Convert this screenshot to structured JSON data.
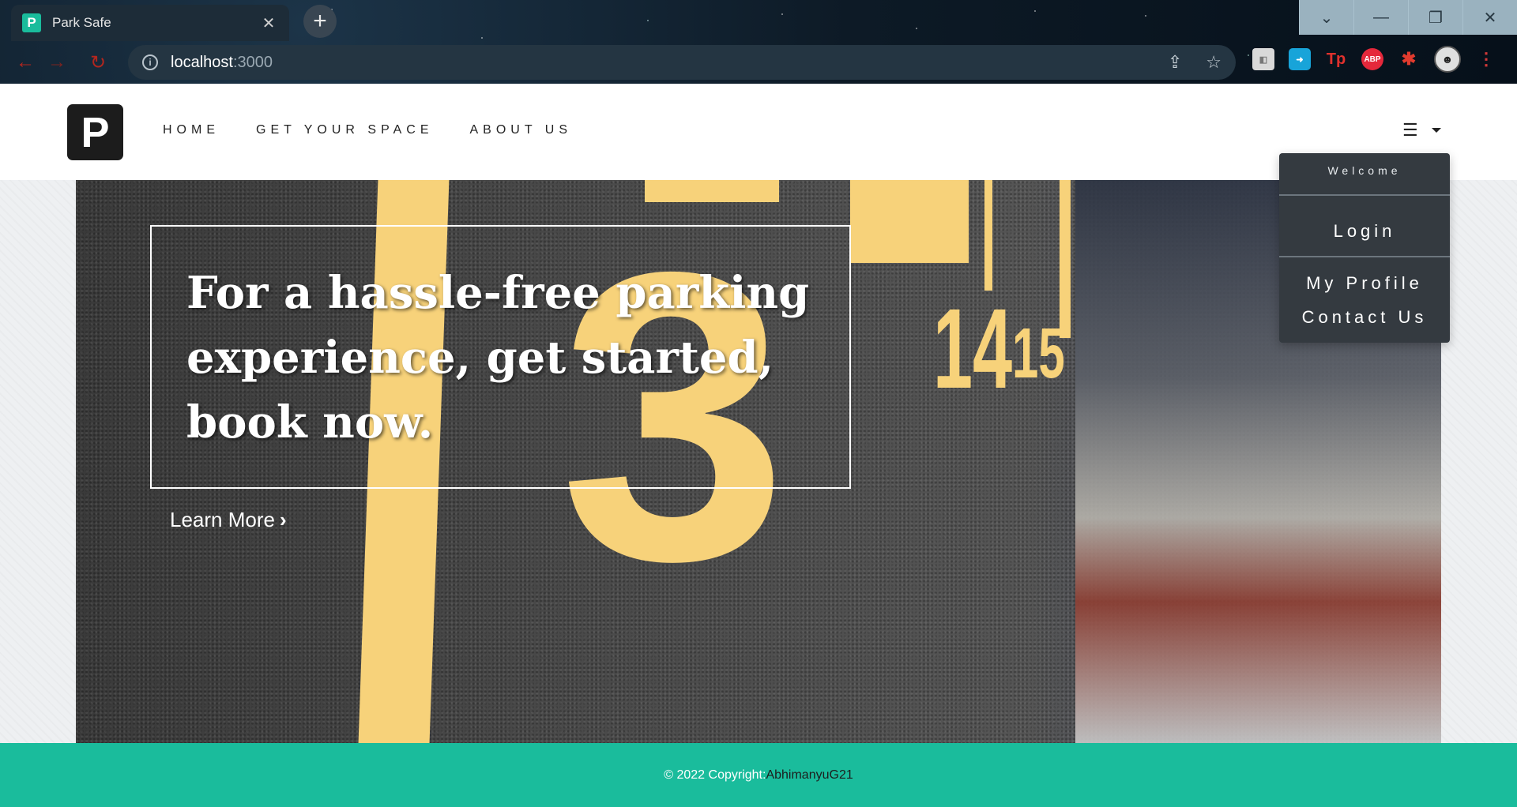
{
  "browser": {
    "tab_title": "Park Safe",
    "favicon_letter": "P",
    "url_host": "localhost",
    "url_port": ":3000",
    "extensions": {
      "tp": "Tp",
      "abp": "ABP"
    }
  },
  "navbar": {
    "logo_letter": "P",
    "links": [
      "HOME",
      "GET YOUR SPACE",
      "ABOUT US"
    ]
  },
  "hero": {
    "heading": "For a hassle-free parking experience, get started, book now.",
    "learn_more": "Learn More",
    "learn_more_chevron": "›",
    "painted_numbers": [
      "1",
      "3",
      "14",
      "15"
    ]
  },
  "dropdown": {
    "welcome": "Welcome",
    "items": [
      "Login",
      "My Profile",
      "Contact Us"
    ]
  },
  "footer": {
    "copyright": "© 2022 Copyright:",
    "author": "AbhimanyuG21"
  },
  "colors": {
    "accent": "#1abc9c",
    "dropdown_bg": "#343a40",
    "parking_paint": "#f7d27a"
  }
}
